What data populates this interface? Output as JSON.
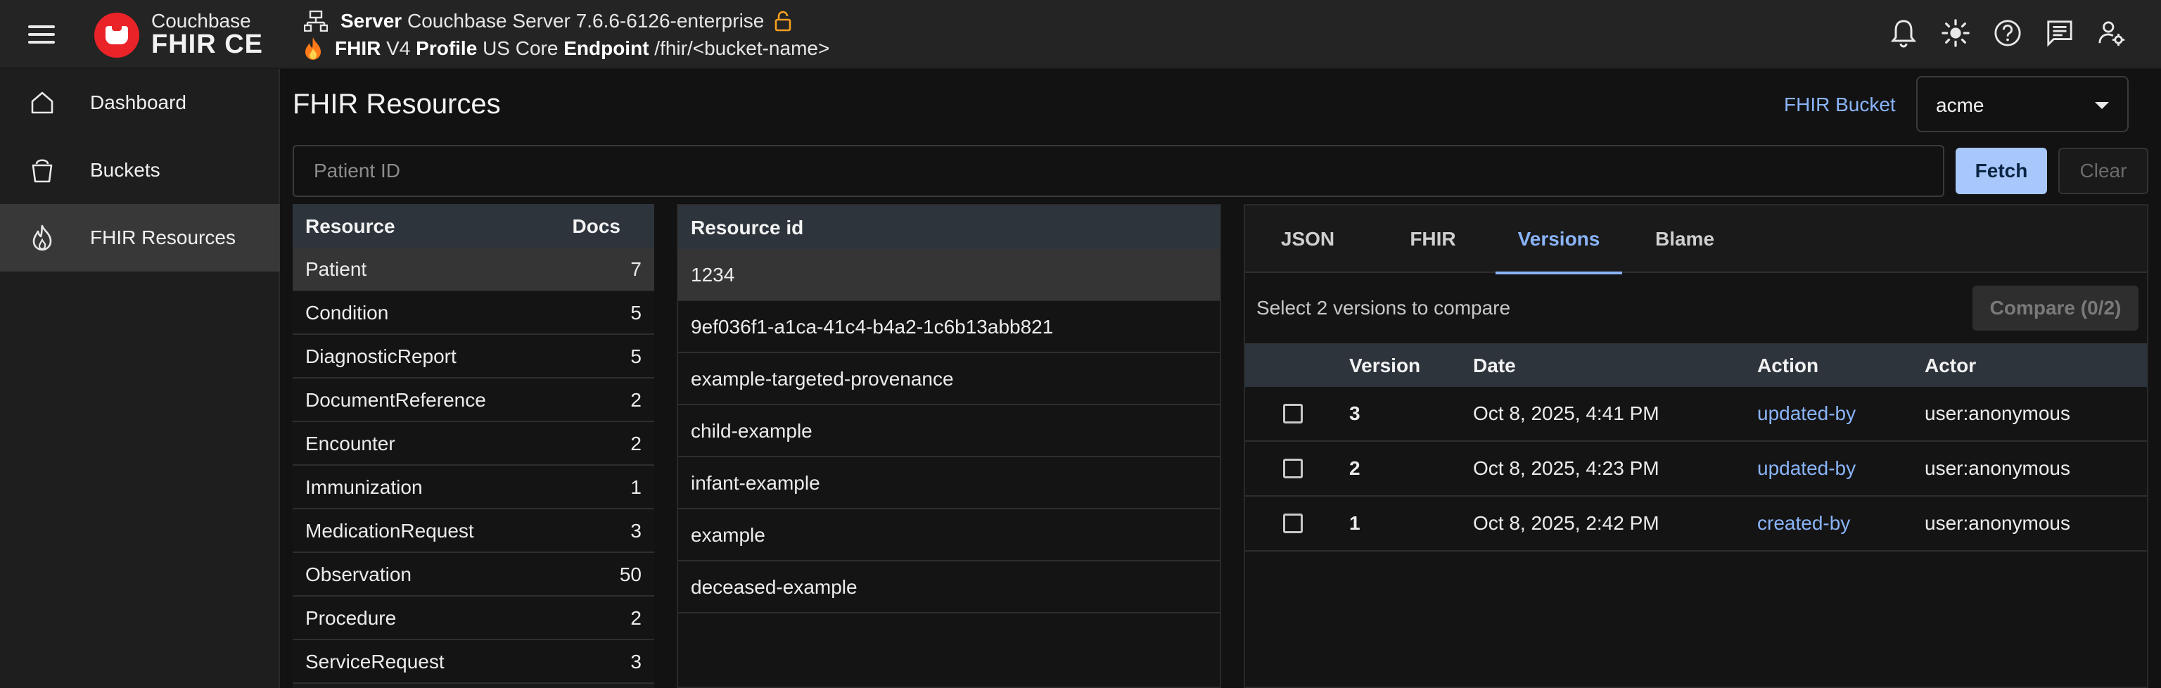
{
  "app": {
    "brand_line1": "Couchbase",
    "brand_line2": "FHIR CE"
  },
  "header": {
    "server_label": "Server",
    "server_value": "Couchbase Server 7.6.6-6126-enterprise",
    "fhir_label": "FHIR",
    "fhir_version": "V4",
    "profile_label": "Profile",
    "profile_value": "US Core",
    "endpoint_label": "Endpoint",
    "endpoint_value": "/fhir/<bucket-name>",
    "icons": [
      "bell-icon",
      "brightness-icon",
      "help-icon",
      "feedback-icon",
      "account-settings-icon"
    ]
  },
  "sidebar": {
    "items": [
      {
        "label": "Dashboard",
        "icon": "home-icon"
      },
      {
        "label": "Buckets",
        "icon": "bucket-icon"
      },
      {
        "label": "FHIR Resources",
        "icon": "fire-icon",
        "active": true
      }
    ]
  },
  "main": {
    "title": "FHIR Resources",
    "bucket_label": "FHIR Bucket",
    "bucket_value": "acme",
    "search": {
      "placeholder": "Patient ID",
      "value": ""
    },
    "fetch_label": "Fetch",
    "clear_label": "Clear"
  },
  "resources": {
    "columns": [
      "Resource",
      "Docs"
    ],
    "rows": [
      {
        "name": "Patient",
        "docs": "7",
        "active": true
      },
      {
        "name": "Condition",
        "docs": "5"
      },
      {
        "name": "DiagnosticReport",
        "docs": "5"
      },
      {
        "name": "DocumentReference",
        "docs": "2"
      },
      {
        "name": "Encounter",
        "docs": "2"
      },
      {
        "name": "Immunization",
        "docs": "1"
      },
      {
        "name": "MedicationRequest",
        "docs": "3"
      },
      {
        "name": "Observation",
        "docs": "50"
      },
      {
        "name": "Procedure",
        "docs": "2"
      },
      {
        "name": "ServiceRequest",
        "docs": "3"
      }
    ]
  },
  "resource_ids": {
    "column": "Resource id",
    "rows": [
      "1234",
      "9ef036f1-a1ca-41c4-b4a2-1c6b13abb821",
      "example-targeted-provenance",
      "child-example",
      "infant-example",
      "example",
      "deceased-example"
    ]
  },
  "detail": {
    "tabs": [
      "JSON",
      "FHIR",
      "Versions",
      "Blame"
    ],
    "active_tab": "Versions",
    "compare_hint": "Select 2 versions to compare",
    "compare_button": "Compare (0/2)",
    "columns": [
      "Version",
      "Date",
      "Action",
      "Actor"
    ],
    "versions": [
      {
        "version": "3",
        "date": "Oct 8, 2025, 4:41 PM",
        "action": "updated-by",
        "actor": "user:anonymous"
      },
      {
        "version": "2",
        "date": "Oct 8, 2025, 4:23 PM",
        "action": "updated-by",
        "actor": "user:anonymous"
      },
      {
        "version": "1",
        "date": "Oct 8, 2025, 2:42 PM",
        "action": "created-by",
        "actor": "user:anonymous"
      }
    ]
  },
  "colors": {
    "accent": "#8ab4f8",
    "primary_button": "#a8c7fa",
    "brand_red": "#ea2328",
    "lock_orange": "#f4a020",
    "fire_orange": "#ff7a18"
  }
}
